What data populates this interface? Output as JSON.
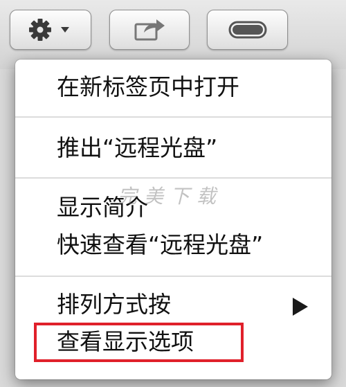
{
  "toolbar": {
    "action_icon": "gear-icon",
    "action_dropdown_icon": "chevron-down-icon",
    "share_icon": "share-icon",
    "toggle_icon": "toggle-pill-icon"
  },
  "menu": {
    "items": [
      {
        "label": "在新标签页中打开"
      },
      {
        "label": "推出“远程光盘”"
      },
      {
        "label": "显示简介"
      },
      {
        "label": "快速查看“远程光盘”"
      },
      {
        "label": "排列方式按",
        "submenu_icon": "submenu-arrow-icon"
      },
      {
        "label": "查看显示选项"
      }
    ]
  },
  "watermark": "完美下载",
  "colors": {
    "highlight": "#e0202a"
  }
}
